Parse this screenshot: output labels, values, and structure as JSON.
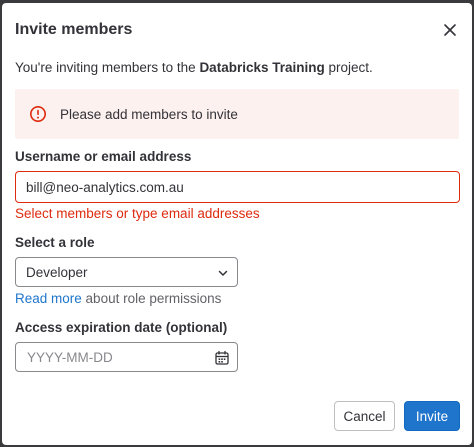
{
  "modal": {
    "title": "Invite members",
    "close_icon": "close-icon",
    "intro_prefix": "You're inviting members to the ",
    "intro_project": "Databricks Training",
    "intro_suffix": " project."
  },
  "alert": {
    "icon": "error-circle-icon",
    "message": "Please add members to invite",
    "color": "#dd2b0e",
    "background": "#fcf1ef"
  },
  "member_field": {
    "label": "Username or email address",
    "value": "bill@neo-analytics.com.au",
    "error": "Select members or type email addresses"
  },
  "role_field": {
    "label": "Select a role",
    "selected": "Developer",
    "icon": "chevron-down-icon",
    "help_link": "Read more",
    "help_text": " about role permissions"
  },
  "expiration_field": {
    "label": "Access expiration date (optional)",
    "placeholder": "YYYY-MM-DD",
    "icon": "calendar-icon"
  },
  "footer": {
    "cancel_label": "Cancel",
    "invite_label": "Invite",
    "primary_color": "#1f75cb"
  }
}
